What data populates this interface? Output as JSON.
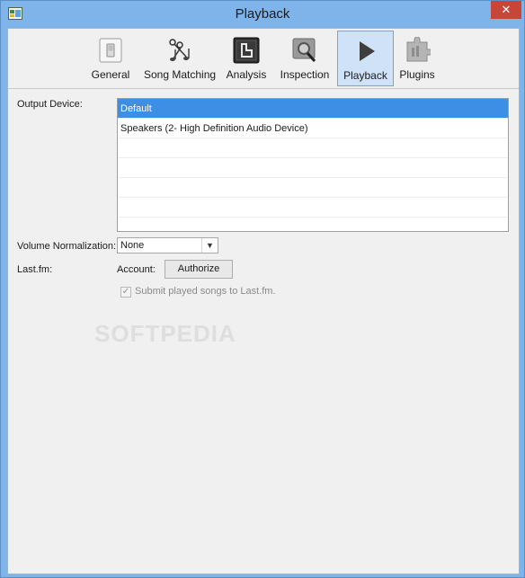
{
  "window": {
    "title": "Playback",
    "close_glyph": "✕"
  },
  "toolbar": {
    "tabs": [
      {
        "label": "General",
        "icon": "switch-icon"
      },
      {
        "label": "Song Matching",
        "icon": "music-notes-icon"
      },
      {
        "label": "Analysis",
        "icon": "analysis-icon"
      },
      {
        "label": "Inspection",
        "icon": "inspection-magnifier-icon"
      },
      {
        "label": "Playback",
        "icon": "play-icon",
        "active": true
      },
      {
        "label": "Plugins",
        "icon": "puzzle-icon"
      }
    ]
  },
  "output_device": {
    "label": "Output Device:",
    "options": [
      "Default",
      "Speakers (2- High Definition Audio Device)"
    ],
    "selected": "Default"
  },
  "volume": {
    "label": "Volume Normalization:",
    "value": "None"
  },
  "lastfm": {
    "label": "Last.fm:",
    "account_label": "Account:",
    "authorize_label": "Authorize",
    "submit_label": "Submit played songs to Last.fm.",
    "submit_checked": true
  },
  "watermark": "SOFTPEDIA",
  "colors": {
    "selection": "#3d8ee5",
    "frame": "#7eb4ea",
    "close": "#c7463a"
  }
}
